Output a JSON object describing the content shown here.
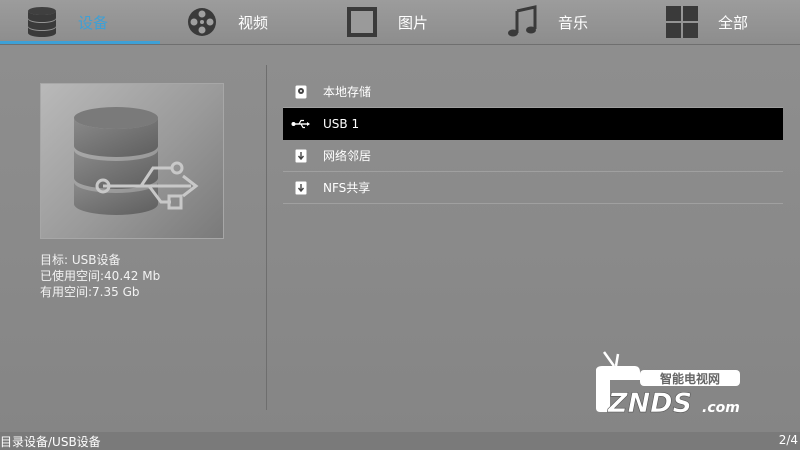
{
  "tabs": [
    {
      "label": "设备",
      "icon": "database-icon",
      "active": true
    },
    {
      "label": "视频",
      "icon": "film-reel-icon",
      "active": false
    },
    {
      "label": "图片",
      "icon": "picture-frame-icon",
      "active": false
    },
    {
      "label": "音乐",
      "icon": "music-note-icon",
      "active": false
    },
    {
      "label": "全部",
      "icon": "grid-icon",
      "active": false
    }
  ],
  "info": {
    "target": "目标: USB设备",
    "used": "已使用空间:40.42 Mb",
    "free": "有用空间:7.35 Gb"
  },
  "devices": [
    {
      "label": "本地存储",
      "icon": "hard-drive-icon",
      "selected": false
    },
    {
      "label": "USB 1",
      "icon": "usb-icon",
      "selected": true
    },
    {
      "label": "网络邻居",
      "icon": "network-share-icon",
      "selected": false
    },
    {
      "label": "NFS共享",
      "icon": "nfs-share-icon",
      "selected": false
    }
  ],
  "logo": {
    "top_text": "智能电视网",
    "brand": "ZNDS",
    "suffix": ".com"
  },
  "status": {
    "path": "目录设备/USB设备",
    "page": "2/4"
  },
  "colors": {
    "accent": "#3ea0d6",
    "selected_row": "#000000",
    "background": "#8a8a8a"
  }
}
